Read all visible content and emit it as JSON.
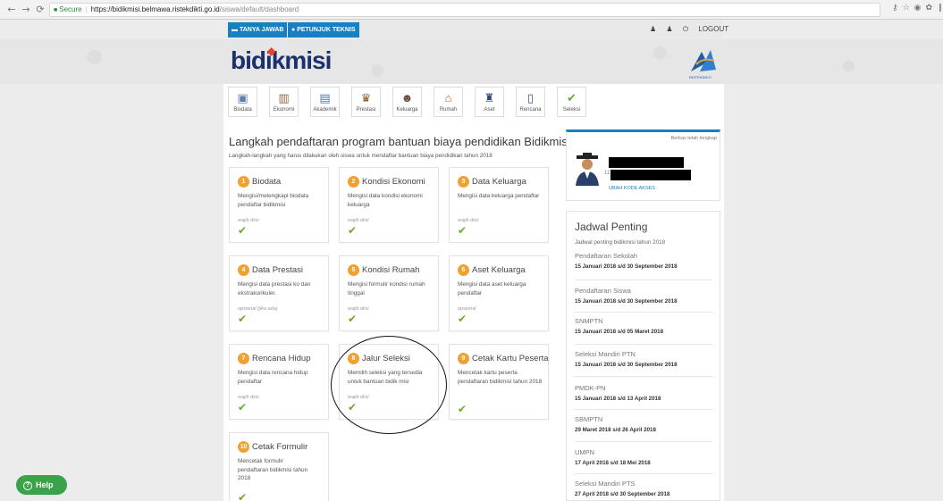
{
  "browser": {
    "secure_label": "Secure",
    "url_host": "https://bidikmisi.belmawa.ristekdikti.go.id",
    "url_path": "/siswa/default/dashboard"
  },
  "topbar": {
    "faq_label": "TANYA JAWAB",
    "guide_label": "PETUNJUK TEKNIS",
    "logout_label": "LOGOUT"
  },
  "header": {
    "logo_text": "bidikmisi",
    "ristek_text": "RISTEKDIKTI"
  },
  "menu": [
    {
      "label": "Biodata",
      "icon": "id-card-icon"
    },
    {
      "label": "Ekonomi",
      "icon": "bank-icon"
    },
    {
      "label": "Akademik",
      "icon": "report-icon"
    },
    {
      "label": "Prestasi",
      "icon": "trophy-icon"
    },
    {
      "label": "Keluarga",
      "icon": "family-icon"
    },
    {
      "label": "Rumah",
      "icon": "house-icon"
    },
    {
      "label": "Aset",
      "icon": "bottle-icon"
    },
    {
      "label": "Rencana",
      "icon": "clipboard-icon"
    },
    {
      "label": "Seleksi",
      "icon": "check-icon"
    }
  ],
  "main": {
    "title": "Langkah pendaftaran program bantuan biaya pendidikan Bidikmisi",
    "subtitle": "Langkah-langkah yang harus dilakukan oleh siswa untuk mendaftar bantuan biaya pendidikan tahun 2018"
  },
  "steps": [
    {
      "num": "1",
      "title": "Biodata",
      "desc": "Mengisi/melengkapi biodata pendaftar bidikmisi",
      "status": "wajib diisi",
      "check": "✔"
    },
    {
      "num": "2",
      "title": "Kondisi Ekonomi",
      "desc": "Mengisi data kondisi ekonomi keluarga",
      "status": "wajib diisi",
      "check": "✔"
    },
    {
      "num": "3",
      "title": "Data Keluarga",
      "desc": "Mengisi data keluarga pendaftar",
      "status": "wajib diisi",
      "check": "✔"
    },
    {
      "num": "4",
      "title": "Data Prestasi",
      "desc": "Mengisi data prestasi ko dan ekstrakurikuler.",
      "status": "opsional (jika ada)",
      "check": "✔"
    },
    {
      "num": "5",
      "title": "Kondisi Rumah",
      "desc": "Mengisi formulir kondisi rumah tinggal",
      "status": "wajib diisi",
      "check": "✔"
    },
    {
      "num": "6",
      "title": "Aset Keluarga",
      "desc": "Mengisi data aset keluarga pendaftar",
      "status": "opsional",
      "check": "✔"
    },
    {
      "num": "7",
      "title": "Rencana Hidup",
      "desc": "Mengisi data rencana hidup pendaftar",
      "status": "wajib diisi",
      "check": "✔"
    },
    {
      "num": "8",
      "title": "Jalur Seleksi",
      "desc": "Memilih seleksi yang tersedia untuk bantuan bidik misi",
      "status": "wajib diisi",
      "check": "✔"
    },
    {
      "num": "9",
      "title": "Cetak Kartu Peserta",
      "desc": "Mencetak kartu peserta pendaftaran bidikmisi tahun 2018",
      "status": "",
      "check": "✔"
    },
    {
      "num": "10",
      "title": "Cetak Formulir",
      "desc": "Mencetak formulir pendaftaran bidikmisi tahun 2018",
      "status": "",
      "check": "✔"
    }
  ],
  "profile": {
    "tag": "Berkas telah lengkap",
    "number_prefix": "11",
    "change_code_label": "UBAH KODE AKSES"
  },
  "schedule": {
    "title": "Jadwal Penting",
    "subtitle": "Jadwal penting bidikmisi tahun 2018",
    "items": [
      {
        "name": "Pendaftaran Sekolah",
        "date": "15 Januari 2018 s/d 30 September 2018"
      },
      {
        "name": "Pendaftaran Siswa",
        "date": "15 Januari 2018 s/d 30 September 2018"
      },
      {
        "name": "SNMPTN",
        "date": "15 Januari 2018 s/d 05 Maret 2018"
      },
      {
        "name": "Seleksi Mandiri PTN",
        "date": "15 Januari 2018 s/d 30 September 2018"
      },
      {
        "name": "PMDK-PN",
        "date": "15 Januari 2018 s/d 13 April 2018"
      },
      {
        "name": "SBMPTN",
        "date": "29 Maret 2018 s/d 26 April 2018"
      },
      {
        "name": "UMPN",
        "date": "17 April 2018 s/d 18 Mei 2018"
      },
      {
        "name": "Seleksi Mandiri PTS",
        "date": "27 April 2018 s/d 30 September 2018"
      }
    ]
  },
  "help": {
    "label": "Help"
  },
  "colors": {
    "accent": "#1a7fc1",
    "step_badge": "#f0a132",
    "check": "#6aa92a",
    "help": "#3aa34a"
  }
}
